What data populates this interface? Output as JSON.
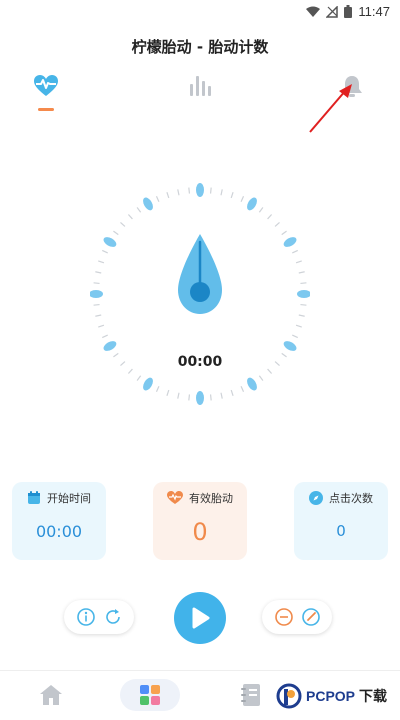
{
  "status_bar": {
    "time": "11:47"
  },
  "header": {
    "title": "柠檬胎动 - 胎动计数"
  },
  "icons": {
    "heart_tab": "heart-pulse-icon",
    "chart_tab": "bar-chart-icon",
    "bell_tab": "bell-icon",
    "start_time": "calendar-icon",
    "valid_moves": "heart-icon",
    "click_count": "compass-icon",
    "info": "info-icon",
    "refresh": "refresh-icon",
    "minus": "minus-icon",
    "edit": "edit-icon",
    "play": "play-icon",
    "home": "home-icon",
    "grid": "grid-icon",
    "notes": "notebook-icon"
  },
  "dial": {
    "time": "00:00"
  },
  "cards": {
    "start": {
      "label": "开始时间",
      "value": "00:00"
    },
    "valid": {
      "label": "有效胎动",
      "value": "0"
    },
    "clicks": {
      "label": "点击次数",
      "value": "0"
    }
  },
  "watermark": {
    "brand": "PCPOP",
    "suffix": "下载"
  },
  "colors": {
    "accent_blue": "#41b3ea",
    "accent_orange": "#f08a4b",
    "card_blue_bg": "#eaf7fd",
    "card_orange_bg": "#fdf1ea"
  }
}
